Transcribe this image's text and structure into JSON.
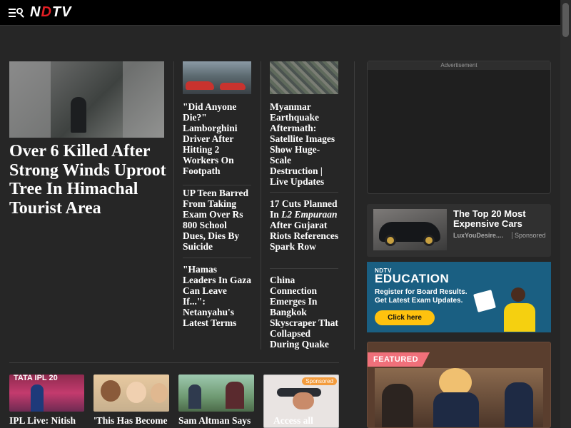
{
  "header": {
    "logo_left": "N",
    "logo_mark": "D",
    "logo_right": "TV"
  },
  "hero": {
    "title": "Over 6 Killed After Strong Winds Uproot Tree In Himachal Tourist Area"
  },
  "col2": {
    "stories": [
      "\"Did Anyone Die?\" Lamborghini Driver After Hitting 2 Workers On Footpath",
      "UP Teen Barred From Taking Exam Over Rs 800 School Dues, Dies By Suicide",
      "\"Hamas Leaders In Gaza Can Leave If...\": Netanyahu's Latest Terms"
    ]
  },
  "col3": {
    "story1": "Myanmar Earthquake Aftermath: Satellite Images Show Huge-Scale Destruction | Live Updates",
    "story2_a": "17 Cuts Planned In ",
    "story2_em": "L2 Empuraan",
    "story2_b": " After Gujarat Riots References Spark Row",
    "story3": "China Connection Emerges In Bangkok Skyscraper That Collapsed During Quake"
  },
  "ad": {
    "label": "Advertisement"
  },
  "sponsored": {
    "title": "The Top 20 Most Expensive Cars",
    "source": "LuxYouDesire....",
    "tag": "Sponsored"
  },
  "edu": {
    "small": "NDTV",
    "big": "EDUCATION",
    "line1": "Register for Board Results.",
    "line2": "Get Latest Exam Updates.",
    "button": "Click here"
  },
  "featured": {
    "tag": "FEATURED"
  },
  "bottom": {
    "items": [
      {
        "title": "IPL Live: Nitish",
        "thumb_text": "TATA IPL 20"
      },
      {
        "title": "'This Has Become"
      },
      {
        "title": "Sam Altman Says"
      },
      {
        "title": "Access all",
        "badge": "Sponsored"
      }
    ]
  },
  "colors": {
    "accent": "#e31e24",
    "background": "#262626",
    "topbar": "#000000",
    "edu_bg": "#1a5f82",
    "edu_button": "#ffc20e",
    "featured_tag": "#f0707a"
  }
}
